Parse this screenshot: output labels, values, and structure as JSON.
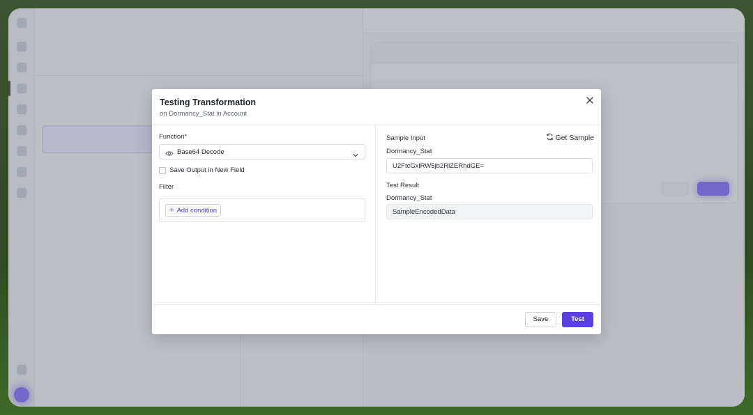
{
  "modal": {
    "title": "Testing Transformation",
    "subtitle": "on Dormancy_Stat in Account",
    "close_icon": "close-icon",
    "function_label": "Function*",
    "function_value": "Base64 Decode",
    "function_icon": "eye-icon",
    "save_output_label": "Save Output in New Field",
    "save_output_checked": false,
    "filter_label": "Filter",
    "add_condition_label": "Add condition",
    "sample_input_label": "Sample Input",
    "get_sample_label": "Get Sample",
    "input_field_label": "Dormancy_Stat",
    "input_value": "U2FtcGxlRW5jb2RlZERhdGE=",
    "test_result_label": "Test Result",
    "result_field_label": "Dormancy_Stat",
    "result_value": "SampleEncodedData",
    "save_button": "Save",
    "test_button": "Test"
  },
  "colors": {
    "primary": "#5b3fe0",
    "overlay": "rgba(110,116,126,0.42)",
    "desktop": "#3c5530"
  }
}
